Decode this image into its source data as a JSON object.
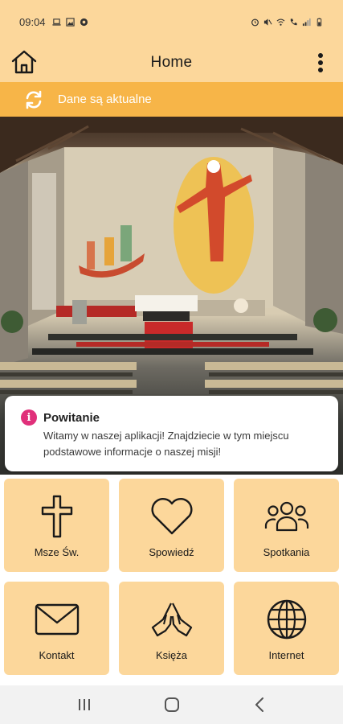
{
  "status_bar": {
    "time": "09:04",
    "left_icons": [
      "laptop-icon",
      "image-icon",
      "settings-icon"
    ],
    "right_icons": [
      "alarm-icon",
      "mute-icon",
      "wifi-icon",
      "call-icon",
      "signal-icon",
      "battery-icon"
    ]
  },
  "app_bar": {
    "title": "Home",
    "left_icon": "home-icon",
    "right_icon": "more-vert-icon"
  },
  "sync_bar": {
    "icon": "sync-icon",
    "text": "Dane są aktualne",
    "color": "#f7b548"
  },
  "hero": {
    "image": "church-interior"
  },
  "welcome": {
    "icon": "info-icon",
    "title": "Powitanie",
    "body": "Witamy w naszej aplikacji! Znajdziecie w tym miejscu podstawowe informacje o naszej misji!"
  },
  "tiles": [
    {
      "label": "Msze Św.",
      "icon": "cross-icon"
    },
    {
      "label": "Spowiedź",
      "icon": "heart-icon"
    },
    {
      "label": "Spotkania",
      "icon": "people-icon"
    },
    {
      "label": "Kontakt",
      "icon": "mail-icon"
    },
    {
      "label": "Księża",
      "icon": "praying-hands-icon"
    },
    {
      "label": "Internet",
      "icon": "globe-icon"
    }
  ],
  "nav_bar": {
    "icons": [
      "recent-apps-icon",
      "home-nav-icon",
      "back-icon"
    ]
  },
  "colors": {
    "primary": "#fcd79b",
    "accent": "#f7b548",
    "info": "#e0307a"
  }
}
